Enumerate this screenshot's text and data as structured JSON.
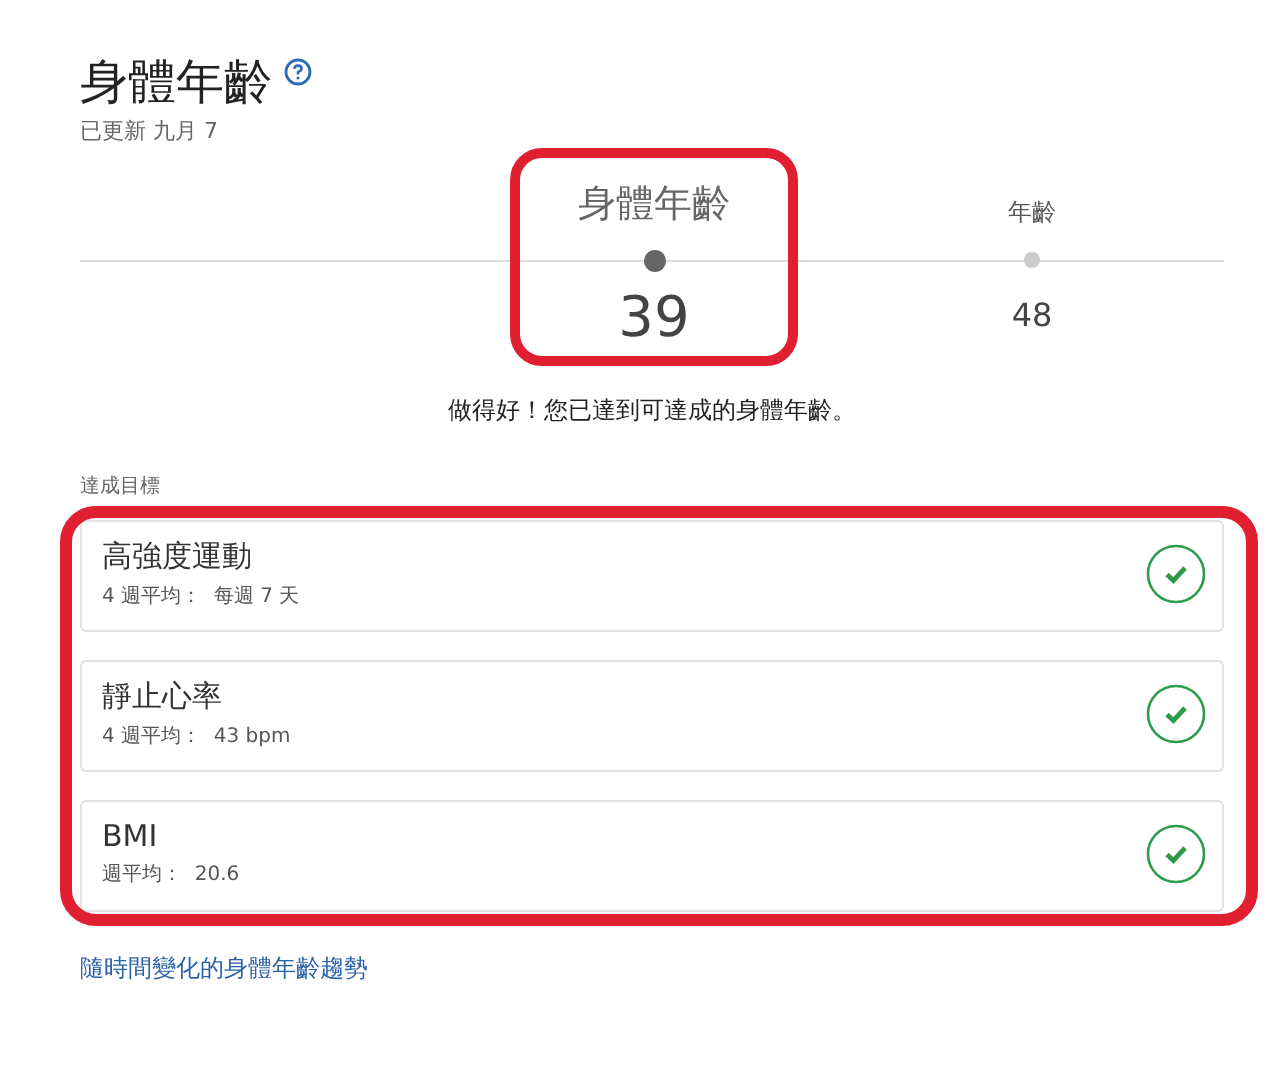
{
  "header": {
    "title": "身體年齡",
    "updated": "已更新 九月 7"
  },
  "markers": [
    {
      "label": "身體年齡",
      "value": "39",
      "selected": true,
      "highlighted": true
    },
    {
      "label": "年齡",
      "value": "48",
      "selected": false,
      "highlighted": false
    }
  ],
  "message": "做得好！您已達到可達成的身體年齡。",
  "goals_heading": "達成目標",
  "goals": [
    {
      "name": "高強度運動",
      "detail": "4 週平均：  每週 7 天",
      "achieved": true
    },
    {
      "name": "靜止心率",
      "detail": "4 週平均：  43 bpm",
      "achieved": true
    },
    {
      "name": "BMI",
      "detail": "週平均：  20.6",
      "achieved": true
    }
  ],
  "goals_highlighted": true,
  "trend_link": "隨時間變化的身體年齡趨勢"
}
